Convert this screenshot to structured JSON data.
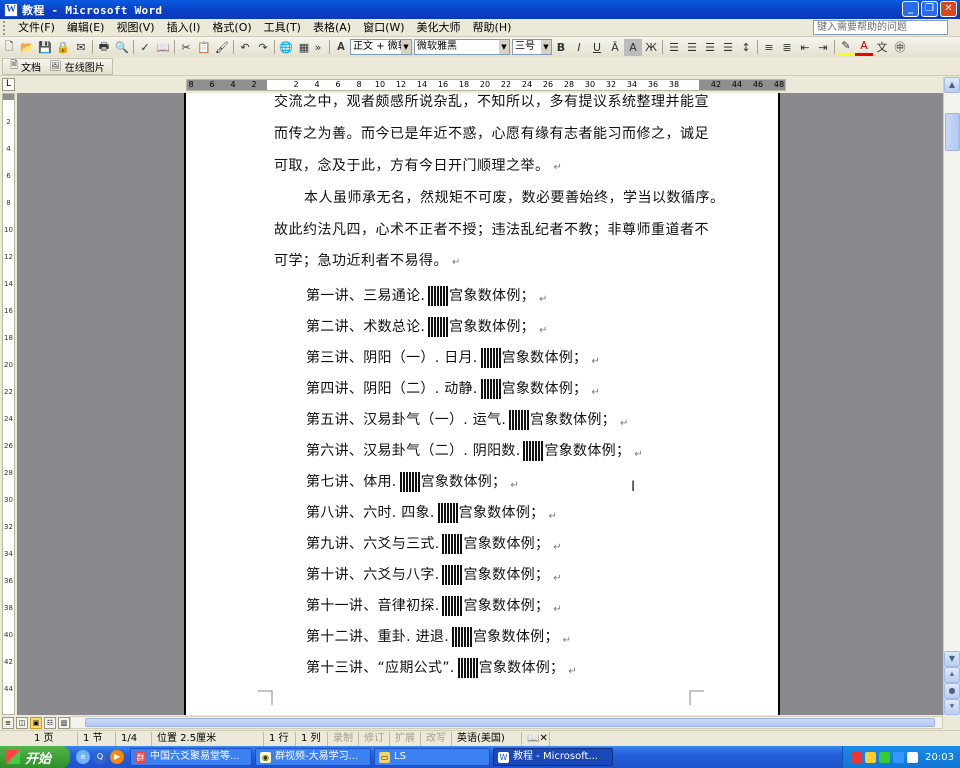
{
  "window": {
    "title": "教程 - Microsoft Word",
    "app_icon": "W"
  },
  "menu": {
    "items": [
      "文件(F)",
      "编辑(E)",
      "视图(V)",
      "插入(I)",
      "格式(O)",
      "工具(T)",
      "表格(A)",
      "窗口(W)",
      "美化大师",
      "帮助(H)"
    ],
    "help_placeholder": "键入需要帮助的问题"
  },
  "format_toolbar": {
    "style": "正文 + 微软",
    "font": "微软雅黑",
    "size": "三号"
  },
  "toolbar3": {
    "doc_label": "文档",
    "online_image_label": "在线图片"
  },
  "ruler": {
    "numbers": [
      "8",
      "6",
      "4",
      "2",
      "",
      "2",
      "4",
      "6",
      "8",
      "10",
      "12",
      "14",
      "16",
      "18",
      "20",
      "22",
      "24",
      "26",
      "28",
      "30",
      "32",
      "34",
      "36",
      "38",
      "",
      "42",
      "44",
      "46",
      "48"
    ]
  },
  "vruler": {
    "numbers": [
      "2",
      "4",
      "6",
      "8",
      "10",
      "12",
      "14",
      "16",
      "18",
      "20",
      "22",
      "24",
      "26",
      "28",
      "30",
      "32",
      "34",
      "36",
      "38",
      "40",
      "42",
      "44"
    ]
  },
  "document": {
    "paragraphs": [
      "交流之中，观者颇感所说杂乱，不知所以，多有提议系统整理并能宣",
      "而传之为善。而今已是年近不惑，心愿有缘有志者能习而修之，诚足",
      "可取，念及于此，方有今日开门顺理之举。",
      "本人虽师承无名，然规矩不可废，数必要善始终，学当以数循序。",
      "故此约法凡四，心术不正者不授；违法乱纪者不教；非尊师重道者不",
      "可学；急功近利者不易得。"
    ],
    "para_mark": "↵",
    "lessons": [
      {
        "title": "第一讲、三易通论.",
        "suffix": "宫象数体例；"
      },
      {
        "title": "第二讲、术数总论.",
        "suffix": "宫象数体例；"
      },
      {
        "title": "第三讲、阴阳（一）. 日月.",
        "suffix": "宫象数体例；"
      },
      {
        "title": "第四讲、阴阳（二）. 动静.",
        "suffix": "宫象数体例；"
      },
      {
        "title": "第五讲、汉易卦气（一）. 运气.",
        "suffix": "宫象数体例；"
      },
      {
        "title": "第六讲、汉易卦气（二）. 阴阳数.",
        "suffix": "宫象数体例；"
      },
      {
        "title": "第七讲、体用.",
        "suffix": "宫象数体例；"
      },
      {
        "title": "第八讲、六时. 四象.",
        "suffix": "宫象数体例；"
      },
      {
        "title": "第九讲、六爻与三式.",
        "suffix": "宫象数体例；"
      },
      {
        "title": "第十讲、六爻与八字.",
        "suffix": "宫象数体例；"
      },
      {
        "title": "第十一讲、音律初探.",
        "suffix": "宫象数体例；"
      },
      {
        "title": "第十二讲、重卦. 进退.",
        "suffix": "宫象数体例；"
      },
      {
        "title": "第十三讲、“应期公式”.",
        "suffix": "宫象数体例；"
      }
    ]
  },
  "status": {
    "page": "1 页",
    "section": "1 节",
    "page_of": "1/4",
    "position": "位置 2.5厘米",
    "line": "1 行",
    "column": "1 列",
    "rec": "录制",
    "trk": "修订",
    "ext": "扩展",
    "ovr": "改写",
    "language": "英语(美国)"
  },
  "taskbar": {
    "start_label": "开始",
    "tasks": [
      "中国六爻聚易堂等...",
      "群视频-大易学习...",
      "LS",
      "教程 - Microsoft..."
    ],
    "clock": "20:03"
  }
}
